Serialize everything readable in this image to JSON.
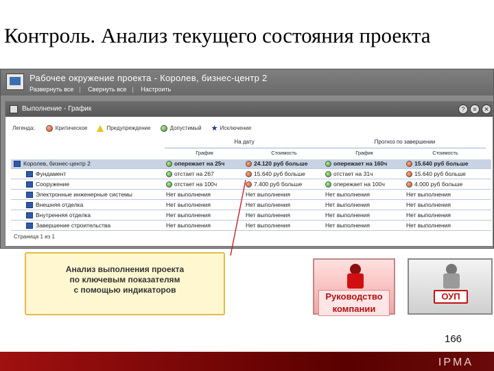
{
  "slide": {
    "title": "Контроль. Анализ текущего состояния проекта",
    "page_number": "166",
    "logo_text": "IPMA"
  },
  "app": {
    "title": "Рабочее окружение проекта - Королев, бизнес-центр 2",
    "menu": [
      "Развернуть все",
      "Свернуть все",
      "Настроить"
    ]
  },
  "panel": {
    "title": "Выполнение - График",
    "buttons": [
      "?",
      "≡",
      "✕"
    ],
    "legend_label": "Легенда:",
    "legend": [
      {
        "label": "Критическое",
        "shape": "red-dot"
      },
      {
        "label": "Предупреждение",
        "shape": "yellow-triangle"
      },
      {
        "label": "Допустимый",
        "shape": "green-dot"
      },
      {
        "label": "Исключение",
        "shape": "star"
      }
    ],
    "group_headers": [
      "На дату",
      "Прогноз по завершении"
    ],
    "column_headers": [
      "График",
      "Стоимость",
      "График",
      "Стоимость"
    ],
    "rows": [
      {
        "name": "Королев, бизнес-центр 2",
        "root": true,
        "cells": [
          {
            "status": "green",
            "text": "опережает на 25ч"
          },
          {
            "status": "red",
            "text": "24.120 руб больше"
          },
          {
            "status": "green",
            "text": "опережает на 160ч"
          },
          {
            "status": "red",
            "text": "15.640 руб больше"
          }
        ]
      },
      {
        "name": "Фундамент",
        "root": false,
        "cells": [
          {
            "status": "green",
            "text": "отстает на 267"
          },
          {
            "status": "red",
            "text": "15.640 руб больше"
          },
          {
            "status": "green",
            "text": "отстает на 31ч"
          },
          {
            "status": "red",
            "text": "15.640 руб больше"
          }
        ]
      },
      {
        "name": "Сооружение",
        "root": false,
        "cells": [
          {
            "status": "green",
            "text": "отстает на 100ч"
          },
          {
            "status": "red",
            "text": "7.400 руб больше"
          },
          {
            "status": "green",
            "text": "опережает на 100ч"
          },
          {
            "status": "red",
            "text": "4.000 руб больше"
          }
        ]
      },
      {
        "name": "Электронные инженерные системы",
        "root": false,
        "cells": [
          {
            "status": "",
            "text": "Нет выполнения"
          },
          {
            "status": "",
            "text": "Нет выполнения"
          },
          {
            "status": "",
            "text": "Нет выполнения"
          },
          {
            "status": "",
            "text": "Нет выполнения"
          }
        ]
      },
      {
        "name": "Внешняя отделка",
        "root": false,
        "cells": [
          {
            "status": "",
            "text": "Нет выполнения"
          },
          {
            "status": "",
            "text": "Нет выполнения"
          },
          {
            "status": "",
            "text": "Нет выполнения"
          },
          {
            "status": "",
            "text": "Нет выполнения"
          }
        ]
      },
      {
        "name": "Внутренняя отделка",
        "root": false,
        "cells": [
          {
            "status": "",
            "text": "Нет выполнения"
          },
          {
            "status": "",
            "text": "Нет выполнения"
          },
          {
            "status": "",
            "text": "Нет выполнения"
          },
          {
            "status": "",
            "text": "Нет выполнения"
          }
        ]
      },
      {
        "name": "Завершение строительства",
        "root": false,
        "cells": [
          {
            "status": "",
            "text": "Нет выполнения"
          },
          {
            "status": "",
            "text": "Нет выполнения"
          },
          {
            "status": "",
            "text": "Нет выполнения"
          },
          {
            "status": "",
            "text": "Нет выполнения"
          }
        ]
      }
    ],
    "pager": "Страница 1 из 1"
  },
  "callout": {
    "line1": "Анализ выполнения проекта",
    "line2": "по ключевым показателям",
    "line3": "с помощью индикаторов"
  },
  "cards": {
    "management_label": "Руководство компании",
    "oup_label": "ОУП"
  }
}
